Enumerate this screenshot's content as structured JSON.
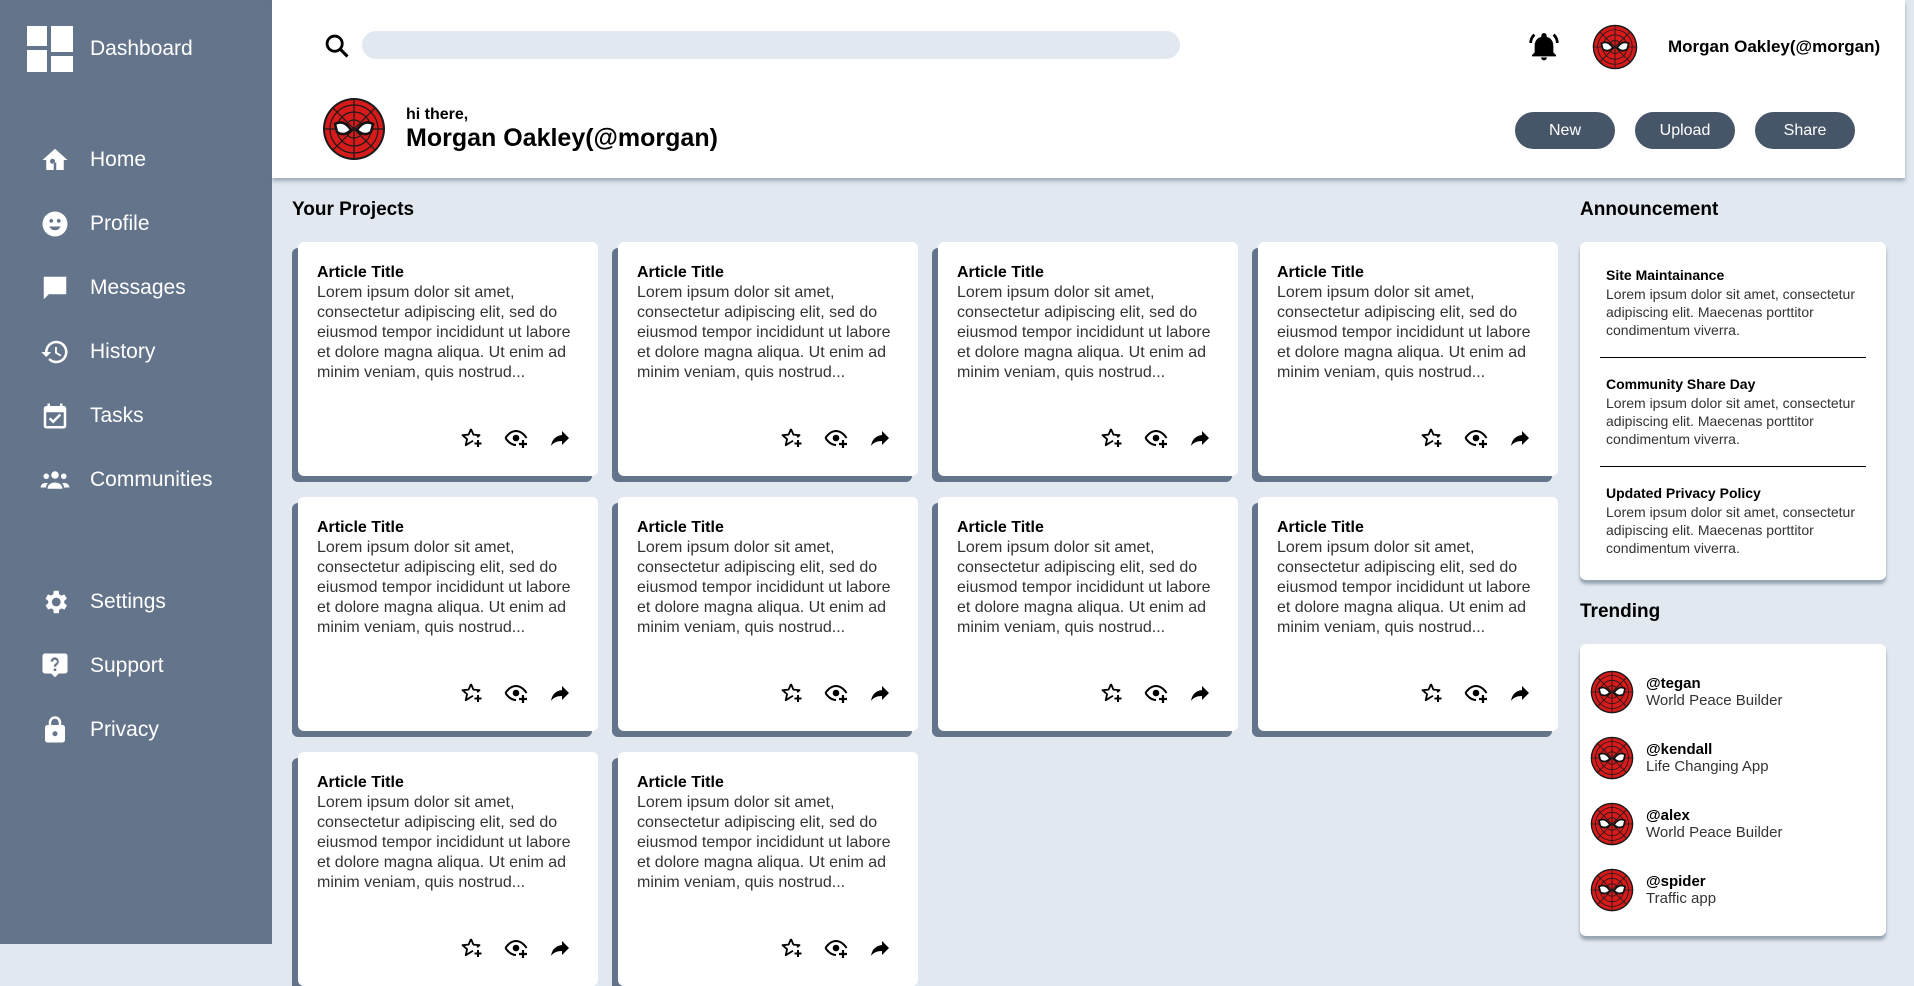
{
  "sidebar": {
    "brand": "Dashboard",
    "main_items": [
      {
        "label": "Home",
        "icon": "home-icon"
      },
      {
        "label": "Profile",
        "icon": "profile-icon"
      },
      {
        "label": "Messages",
        "icon": "message-icon"
      },
      {
        "label": "History",
        "icon": "history-icon"
      },
      {
        "label": "Tasks",
        "icon": "calendar-check-icon"
      },
      {
        "label": "Communities",
        "icon": "group-icon"
      }
    ],
    "secondary_items": [
      {
        "label": "Settings",
        "icon": "gear-icon"
      },
      {
        "label": "Support",
        "icon": "help-icon"
      },
      {
        "label": "Privacy",
        "icon": "lock-icon"
      }
    ]
  },
  "header": {
    "search_placeholder": "",
    "user_handle": "Morgan Oakley(@morgan)",
    "greeting": "hi there,",
    "greeting_name": "Morgan Oakley(@morgan)",
    "buttons": {
      "new": "New",
      "upload": "Upload",
      "share": "Share"
    }
  },
  "projects": {
    "title": "Your Projects",
    "cards": [
      {
        "title": "Article Title",
        "body": "Lorem ipsum dolor sit amet, consectetur adipiscing elit, sed do eiusmod tempor incididunt ut labore et dolore magna aliqua. Ut enim ad minim veniam, quis nostrud..."
      },
      {
        "title": "Article Title",
        "body": "Lorem ipsum dolor sit amet, consectetur adipiscing elit, sed do eiusmod tempor incididunt ut labore et dolore magna aliqua. Ut enim ad minim veniam, quis nostrud..."
      },
      {
        "title": "Article Title",
        "body": "Lorem ipsum dolor sit amet, consectetur adipiscing elit, sed do eiusmod tempor incididunt ut labore et dolore magna aliqua. Ut enim ad minim veniam, quis nostrud..."
      },
      {
        "title": "Article Title",
        "body": "Lorem ipsum dolor sit amet, consectetur adipiscing elit, sed do eiusmod tempor incididunt ut labore et dolore magna aliqua. Ut enim ad minim veniam, quis nostrud..."
      },
      {
        "title": "Article Title",
        "body": "Lorem ipsum dolor sit amet, consectetur adipiscing elit, sed do eiusmod tempor incididunt ut labore et dolore magna aliqua. Ut enim ad minim veniam, quis nostrud..."
      },
      {
        "title": "Article Title",
        "body": "Lorem ipsum dolor sit amet, consectetur adipiscing elit, sed do eiusmod tempor incididunt ut labore et dolore magna aliqua. Ut enim ad minim veniam, quis nostrud..."
      },
      {
        "title": "Article Title",
        "body": "Lorem ipsum dolor sit amet, consectetur adipiscing elit, sed do eiusmod tempor incididunt ut labore et dolore magna aliqua. Ut enim ad minim veniam, quis nostrud..."
      },
      {
        "title": "Article Title",
        "body": "Lorem ipsum dolor sit amet, consectetur adipiscing elit, sed do eiusmod tempor incididunt ut labore et dolore magna aliqua. Ut enim ad minim veniam, quis nostrud..."
      },
      {
        "title": "Article Title",
        "body": "Lorem ipsum dolor sit amet, consectetur adipiscing elit, sed do eiusmod tempor incididunt ut labore et dolore magna aliqua. Ut enim ad minim veniam, quis nostrud..."
      },
      {
        "title": "Article Title",
        "body": "Lorem ipsum dolor sit amet, consectetur adipiscing elit, sed do eiusmod tempor incididunt ut labore et dolore magna aliqua. Ut enim ad minim veniam, quis nostrud..."
      }
    ]
  },
  "announcement": {
    "title": "Announcement",
    "items": [
      {
        "title": "Site Maintainance",
        "body": "Lorem ipsum dolor sit amet, consectetur adipiscing elit. Maecenas porttitor condimentum viverra."
      },
      {
        "title": "Community Share Day",
        "body": "Lorem ipsum dolor sit amet, consectetur adipiscing elit. Maecenas porttitor condimentum viverra."
      },
      {
        "title": "Updated Privacy Policy",
        "body": "Lorem ipsum dolor sit amet, consectetur adipiscing elit. Maecenas porttitor condimentum viverra."
      }
    ]
  },
  "trending": {
    "title": "Trending",
    "items": [
      {
        "handle": "@tegan",
        "subtitle": "World Peace Builder"
      },
      {
        "handle": "@kendall",
        "subtitle": "Life Changing App"
      },
      {
        "handle": "@alex",
        "subtitle": "World Peace Builder"
      },
      {
        "handle": "@spider",
        "subtitle": "Traffic app"
      }
    ]
  },
  "colors": {
    "sidebar": "#64748b",
    "background": "#e2e8f0",
    "button": "#475569",
    "avatar_red": "#d91a1a"
  }
}
